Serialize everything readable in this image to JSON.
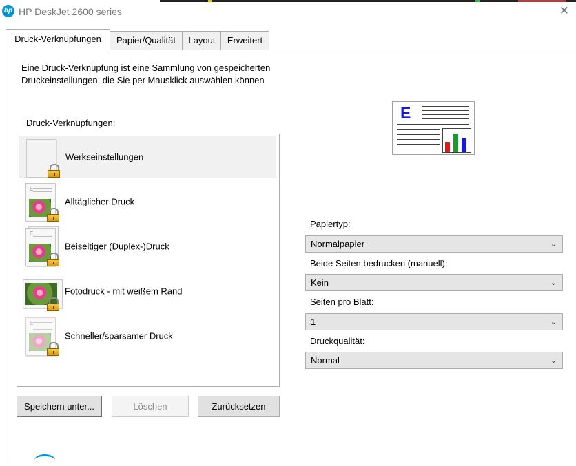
{
  "window": {
    "title": "HP DeskJet 2600 series",
    "logo_text": "hp",
    "close_glyph": "✕"
  },
  "tabs": [
    {
      "label": "Druck-Verknüpfungen",
      "active": true
    },
    {
      "label": "Papier/Qualität",
      "active": false
    },
    {
      "label": "Layout",
      "active": false
    },
    {
      "label": "Erweitert",
      "active": false
    }
  ],
  "description": "Eine Druck-Verknüpfung ist eine Sammlung von gespeicherten Druckeinstellungen, die Sie per Mausklick auswählen können",
  "shortcuts": {
    "label": "Druck-Verknüpfungen:",
    "items": [
      {
        "label": "Werkseinstellungen",
        "selected": true,
        "icon": "blank-page-icon"
      },
      {
        "label": "Alltäglicher Druck",
        "selected": false,
        "icon": "document-photo-icon"
      },
      {
        "label": "Beiseitiger (Duplex-)Druck",
        "selected": false,
        "icon": "duplex-document-icon"
      },
      {
        "label": "Fotodruck - mit weißem Rand",
        "selected": false,
        "icon": "photo-print-icon"
      },
      {
        "label": "Schneller/sparsamer Druck",
        "selected": false,
        "icon": "economy-document-icon"
      }
    ]
  },
  "buttons": {
    "save_as": "Speichern unter...",
    "delete": "Löschen",
    "reset": "Zurücksetzen"
  },
  "preview": {
    "letter": "E",
    "bar_colors": [
      "#e01b1b",
      "#1a9a2a",
      "#1a1adb"
    ],
    "bar_levels": [
      0.45,
      0.9,
      0.65
    ]
  },
  "settings": {
    "paper_type": {
      "label": "Papiertyp:",
      "value": "Normalpapier"
    },
    "duplex": {
      "label": "Beide Seiten bedrucken (manuell):",
      "value": "Kein"
    },
    "pages_per_sheet": {
      "label": "Seiten pro Blatt:",
      "value": "1"
    },
    "quality": {
      "label": "Druckqualität:",
      "value": "Normal"
    }
  }
}
